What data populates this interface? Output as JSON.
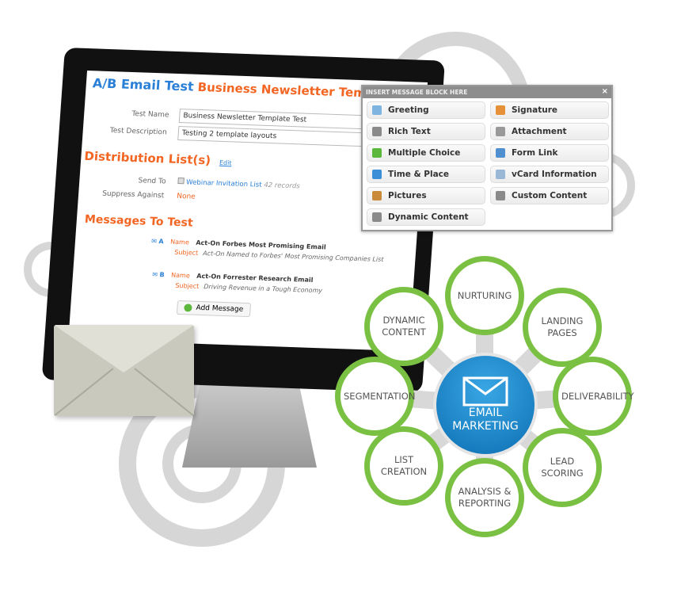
{
  "ab_test": {
    "title_prefix": "A/B Email Test",
    "title_name": "Business Newsletter Template Test",
    "test_name_label": "Test Name",
    "test_name_value": "Business Newsletter Template Test",
    "test_description_label": "Test Description",
    "test_description_value": "Testing 2 template layouts",
    "distribution_heading": "Distribution List(s)",
    "edit_link": "Edit",
    "send_to_label": "Send To",
    "send_to_value": "Webinar Invitation List",
    "send_to_count": "42 records",
    "suppress_label": "Suppress Against",
    "suppress_value": "None",
    "messages_heading": "Messages To Test",
    "messages": [
      {
        "letter": "A",
        "name_label": "Name",
        "name": "Act-On Forbes Most Promising Email",
        "subject_label": "Subject",
        "subject": "Act-On Named to Forbes' Most Promising Companies List"
      },
      {
        "letter": "B",
        "name_label": "Name",
        "name": "Act-On Forrester Research Email",
        "subject_label": "Subject",
        "subject": "Driving Revenue in a Tough Economy"
      }
    ],
    "add_message_button": "Add Message"
  },
  "insert_panel": {
    "title": "INSERT MESSAGE BLOCK HERE",
    "close": "×",
    "blocks": [
      {
        "label": "Greeting",
        "icon": "speech-bubble-icon",
        "color": "#7fb3e0"
      },
      {
        "label": "Signature",
        "icon": "person-icon",
        "color": "#e6913a"
      },
      {
        "label": "Rich Text",
        "icon": "text-icon",
        "color": "#8a8a8a"
      },
      {
        "label": "Attachment",
        "icon": "paperclip-icon",
        "color": "#999999"
      },
      {
        "label": "Multiple Choice",
        "icon": "check-circle-icon",
        "color": "#5cb83c"
      },
      {
        "label": "Form Link",
        "icon": "form-icon",
        "color": "#4f8fd0"
      },
      {
        "label": "Time & Place",
        "icon": "alarm-clock-icon",
        "color": "#3a8fd8"
      },
      {
        "label": "vCard Information",
        "icon": "vcard-icon",
        "color": "#9bb7d6"
      },
      {
        "label": "Pictures",
        "icon": "pictures-icon",
        "color": "#c98a3a"
      },
      {
        "label": "Custom Content",
        "icon": "text-icon",
        "color": "#8a8a8a"
      },
      {
        "label": "Dynamic Content",
        "icon": "text-icon",
        "color": "#8a8a8a"
      }
    ]
  },
  "diagram": {
    "center": {
      "line1": "EMAIL",
      "line2": "MARKETING",
      "icon": "envelope-icon"
    },
    "nodes": [
      "NURTURING",
      "LANDING PAGES",
      "DELIVERABILITY",
      "LEAD SCORING",
      "ANALYSIS & REPORTING",
      "LIST CREATION",
      "SEGMENTATION",
      "DYNAMIC CONTENT"
    ],
    "colors": {
      "ring": "#7ac143",
      "hub": "#1a88cc"
    }
  }
}
